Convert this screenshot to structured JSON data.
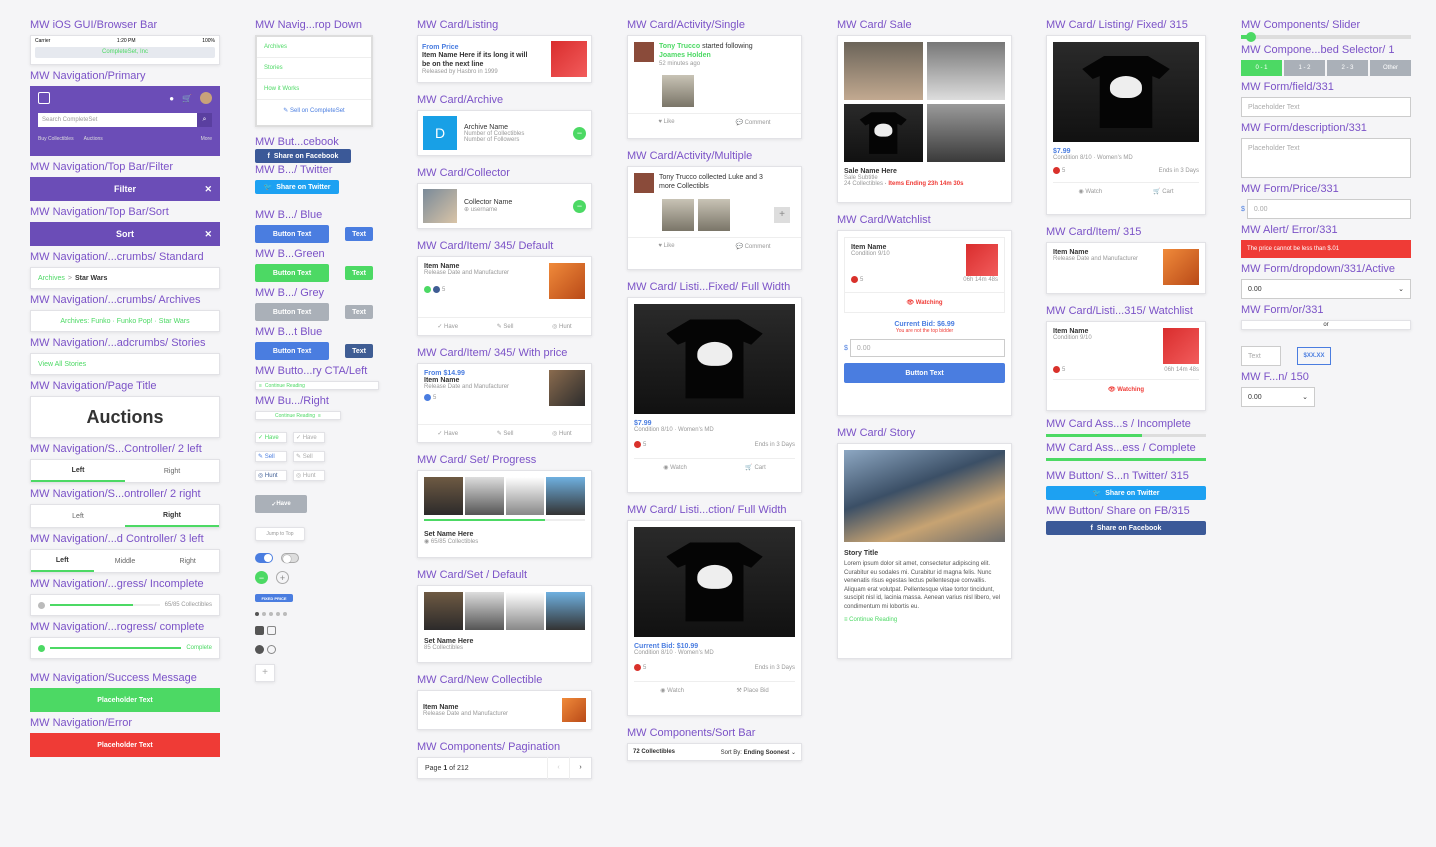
{
  "col1": {
    "ios_label": "MW iOS GUI/Browser Bar",
    "carrier": "Carrier",
    "time": "1:20 PM",
    "battery": "100%",
    "url": "CompleteSet, Inc",
    "nav_primary_label": "MW Navigation/Primary",
    "search_placeholder": "Search CompleteSet",
    "nav_links": [
      "Buy Collectibles",
      "Auctions"
    ],
    "more": "More",
    "filter_label": "MW Navigation/Top Bar/Filter",
    "filter_text": "Filter",
    "sort_label": "MW Navigation/Top Bar/Sort",
    "sort_text": "Sort",
    "crumbs_std_label": "MW Navigation/...crumbs/ Standard",
    "crumbs_std_a": "Archives",
    "crumbs_std_sep": ">",
    "crumbs_std_b": "Star Wars",
    "crumbs_arch_label": "MW Navigation/...crumbs/ Archives",
    "crumbs_arch_text": "Archives: Funko · Funko Pop! · Star Wars",
    "crumbs_stories_label": "MW Navigation/...adcrumbs/ Stories",
    "crumbs_stories_text": "View All Stories",
    "page_title_label": "MW Navigation/Page Title",
    "page_title": "Auctions",
    "seg2l_label": "MW Navigation/S...Controller/ 2 left",
    "seg2l": [
      "Left",
      "Right"
    ],
    "seg2r_label": "MW Navigation/S...ontroller/ 2 right",
    "seg2r": [
      "Left",
      "Right"
    ],
    "seg3_label": "MW Navigation/...d Controller/ 3 left",
    "seg3": [
      "Left",
      "Middle",
      "Right"
    ],
    "prog_inc_label": "MW Navigation/...gress/ Incomplete",
    "prog_inc_text": "65/85 Collectibles",
    "prog_inc_value": 0.76,
    "prog_comp_label": "MW Navigation/...rogress/ complete",
    "prog_comp_text": "Complete",
    "prog_comp_value": 1,
    "success_label": "MW Navigation/Success Message",
    "success_text": "Placeholder Text",
    "error_label": "MW Navigation/Error",
    "error_text": "Placeholder Text"
  },
  "col2": {
    "dropdown_label": "MW Navig...rop Down",
    "dropdown_items": [
      "Archives",
      "Stories",
      "How it Works"
    ],
    "dropdown_sell": "Sell on CompleteSet",
    "fb_label": "MW But...cebook",
    "fb_text": "Share on Facebook",
    "tw_label": "MW B.../ Twitter",
    "tw_text": "Share on Twitter",
    "blue_label": "MW B.../ Blue",
    "blue_text": "Button Text",
    "blue_small": "Text",
    "green_label": "MW B...Green",
    "green_text": "Button Text",
    "green_small": "Text",
    "grey_label": "MW B.../ Grey",
    "grey_text": "Button Text",
    "grey_small": "Text",
    "navy_label": "MW B...t Blue",
    "navy_text": "Button Text",
    "navy_small": "Text",
    "cta_left_label": "MW Butto...ry CTA/Left",
    "cta_left_text": "Continue Reading",
    "cta_right_label": "MW Bu.../Right",
    "cta_right_text": "Continue Reading",
    "chips": [
      "Have",
      "Have",
      "Sell",
      "Sell",
      "Hunt",
      "Hunt"
    ],
    "have_btn": "Have",
    "jump_btn": "Jump to Top",
    "fixed_price": "FIXED PRICE"
  },
  "col3": {
    "listing_label": "MW Card/Listing",
    "listing_from": "From Price",
    "listing_name": "Item Name Here if its long it will be on the next line",
    "listing_rel": "Released by Hasbro in 1999",
    "archive_label": "MW Card/Archive",
    "archive_name": "Archive Name",
    "archive_sub1": "Number of Collectibles",
    "archive_sub2": "Number of Followers",
    "collector_label": "MW Card/Collector",
    "collector_name": "Collector Name",
    "collector_user": "username",
    "item345_label": "MW Card/Item/ 345/ Default",
    "item_name": "Item Name",
    "item_rel": "Release Date and Manufacturer",
    "item_count": "5",
    "acts": [
      "Have",
      "Sell",
      "Hunt"
    ],
    "item345p_label": "MW Card/Item/ 345/ With price",
    "item345p_price": "From $14.99",
    "set_prog_label": "MW Card/ Set/ Progress",
    "set_name": "Set Name Here",
    "set_prog_count": "65/85 Collectibles",
    "set_prog_value": 0.75,
    "set_def_label": "MW Card/Set / Default",
    "set_def_count": "85 Collectibles",
    "new_label": "MW Card/New Collectible",
    "pag_label": "MW Components/ Pagination",
    "pag_page": "Page",
    "pag_current": "1",
    "pag_of": "of 212"
  },
  "col4": {
    "act_single_label": "MW Card/Activity/Single",
    "act_user": "Tony Trucco",
    "act_single_verb": "started following",
    "act_single_target": "Joames Holden",
    "act_time": "52 minutes ago",
    "like": "Like",
    "comment": "Comment",
    "act_multi_label": "MW Card/Activity/Multiple",
    "act_multi_text": "Tony Trucco collected Luke and 3 more Collectibls",
    "fixed_label": "MW Card/ Listi...Fixed/ Full Width",
    "price": "$7.99",
    "cond": "Condition 8/10 · Women's MD",
    "ends": "Ends in 3 Days",
    "count": "5",
    "watch": "Watch",
    "cart": "Cart",
    "auction_label": "MW Card/ Listi...ction/ Full Width",
    "bid": "Current Bid: $10.99",
    "place_bid": "Place Bid",
    "sortbar_label": "MW Components/Sort Bar",
    "sortbar_count": "72 Collectibles",
    "sortbar_by": "Sort By:",
    "sortbar_val": "Ending Soonest"
  },
  "col5": {
    "sale_label": "MW Card/ Sale",
    "sale_name": "Sale Name Here",
    "sale_sub": "Sale Subtitle",
    "sale_count": "24 Collectibles",
    "sale_ends": "Items Ending 23h 14m 30s",
    "watch_label": "MW Card/Watchlist",
    "watch_item": "Item Name",
    "watch_cond": "Condition 9/10",
    "watch_count": "5",
    "watch_time": "06h 14m 48s",
    "watching": "Watching",
    "watch_bid": "Current Bid: $6.99",
    "watch_note": "You are not the top bidder",
    "watch_currency": "$",
    "watch_input": "0.00",
    "watch_btn": "Button Text",
    "story_label": "MW Card/ Story",
    "story_title": "Story Title",
    "story_body": "Lorem ipsum dolor sit amet, consectetur adipiscing elit. Curabitur eu sodales mi. Curabitur id magna felis. Nunc venenatis risus egestas lectus pellentesque convallis. Aliquam erat volutpat. Pellentesque vitae tortor tincidunt, suscipit nisl id, lacinia massa. Aenean varius nisl libero, vel condimentum mi lobortis eu.",
    "story_cta": "Continue Reading"
  },
  "col6": {
    "fixed315_label": "MW Card/ Listing/ Fixed/ 315",
    "price": "$7.99",
    "cond": "Condition 8/10 · Women's MD",
    "count": "5",
    "ends": "Ends in 3 Days",
    "watch": "Watch",
    "cart": "Cart",
    "item315_label": "MW Card/Item/ 315",
    "item_name": "Item Name",
    "item_rel": "Release Date and Manufacturer",
    "wl315_label": "MW Card/Listi...315/ Watchlist",
    "wl_cond": "Condition 9/10",
    "wl_count": "5",
    "wl_time": "06h 14m 48s",
    "watching": "Watching",
    "ass_inc_label": "MW Card Ass...s / Incomplete",
    "ass_comp_label": "MW Card Ass...ess / Complete",
    "tw315_label": "MW Button/ S...n Twitter/ 315",
    "tw_text": "Share on Twitter",
    "fb315_label": "MW Button/ Share on FB/315",
    "fb_text": "Share on Facebook"
  },
  "col7": {
    "slider_label": "MW Components/ Slider",
    "slider_value": 0.06,
    "combined_label": "MW Compone...bed Selector/ 1",
    "combined": [
      "0 - 1",
      "1 - 2",
      "2 - 3",
      "Other"
    ],
    "field_label": "MW Form/field/331",
    "field_ph": "Placeholder Text",
    "desc_label": "MW Form/description/331",
    "desc_ph": "Placeholder Text",
    "price_label": "MW Form/Price/331",
    "price_cur": "$",
    "price_ph": "0.00",
    "alert_label": "MW Alert/ Error/331",
    "alert_text": "The price cannot be less than $.01",
    "dd_label": "MW Form/dropdown/331/Active",
    "dd_val": "0.00",
    "or_label": "MW Form/or/331",
    "or_text": "or",
    "text_ph": "Text",
    "xx": "$XX.XX",
    "f150_label": "MW F...n/ 150",
    "f150_val": "0.00"
  },
  "colors": {
    "accent": "#6b4db7",
    "green": "#4cd964",
    "blue": "#4a7de0",
    "red": "#ef3b36"
  }
}
